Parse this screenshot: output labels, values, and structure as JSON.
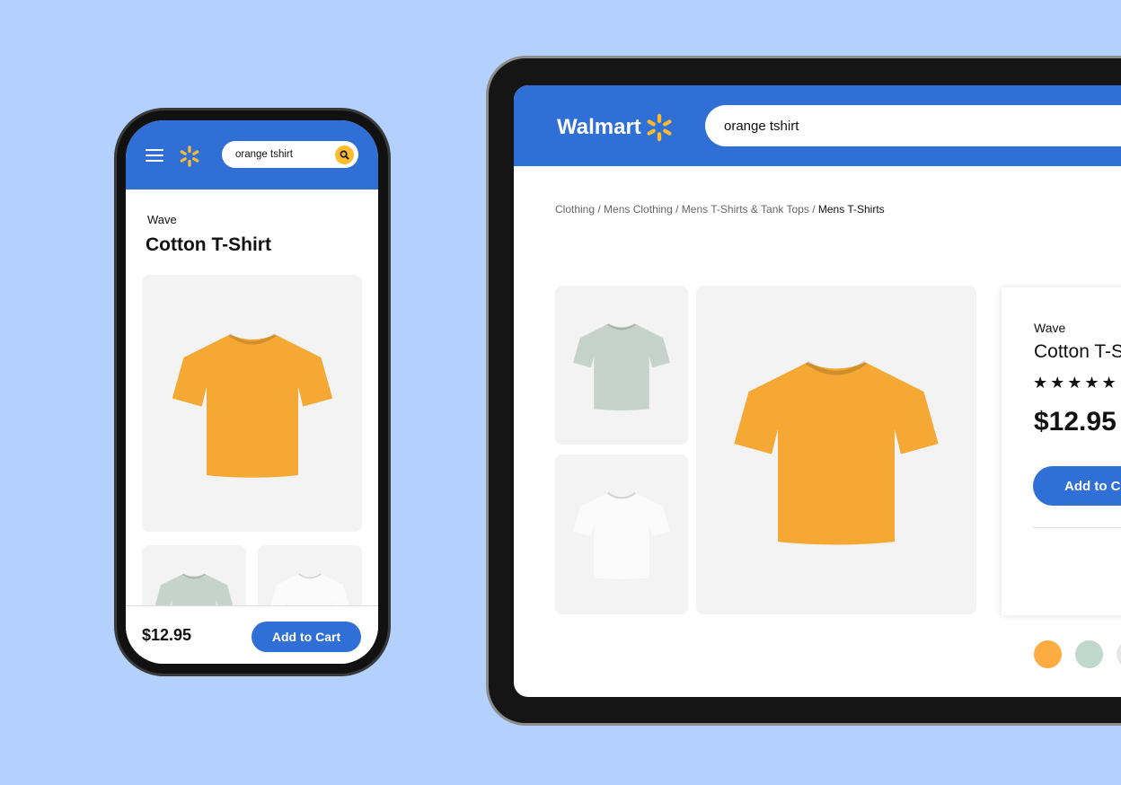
{
  "mobile": {
    "search": {
      "value": "orange tshirt",
      "icon": "search-icon"
    },
    "product": {
      "brand": "Wave",
      "title": "Cotton T-Shirt",
      "price": "$12.95"
    },
    "add_to_cart": "Add to Cart"
  },
  "tablet": {
    "logo": "Walmart",
    "search": {
      "value": "orange tshirt"
    },
    "breadcrumb": [
      "Clothing",
      "Mens Clothing",
      "Mens T-Shirts & Tank Tops",
      "Mens T-Shirts"
    ],
    "product": {
      "brand": "Wave",
      "title": "Cotton T-Shirt",
      "rating": 5,
      "price": "$12.95"
    },
    "add_to_cart": "Add to Cart",
    "swatches": [
      "#fdac42",
      "#bfd8cb",
      "#e6e6e6"
    ]
  },
  "colors": {
    "brand_blue": "#2f6fd6",
    "spark_yellow": "#fdbb30",
    "shirt_orange": "#f5a833",
    "shirt_sage": "#c5d3cc",
    "shirt_white": "#f4f4f4"
  }
}
